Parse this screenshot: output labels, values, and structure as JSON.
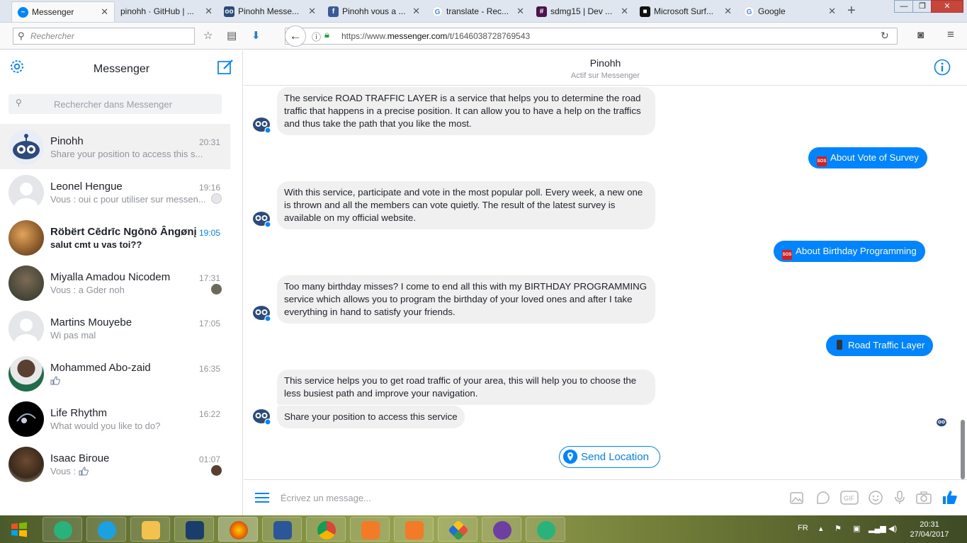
{
  "browser": {
    "tabs": [
      {
        "label": "Messenger",
        "favicon": "messenger-icon",
        "color": "#0084ff"
      },
      {
        "label": "pinohh · GitHub | ...",
        "favicon": "github-icon",
        "color": "#222222"
      },
      {
        "label": "Pinohh Messe...",
        "favicon": "pinohh-icon",
        "color": "#2c4a7a"
      },
      {
        "label": "Pinohh vous a ...",
        "favicon": "facebook-icon",
        "color": "#3b5998"
      },
      {
        "label": "translate - Rec...",
        "favicon": "google-icon",
        "color": "#4285f4"
      },
      {
        "label": "sdmg15 | Dev ...",
        "favicon": "slack-icon",
        "color": "#4a154b"
      },
      {
        "label": "Microsoft Surf...",
        "favicon": "ms-icon",
        "color": "#111111"
      },
      {
        "label": "Google",
        "favicon": "google-icon",
        "color": "#4285f4"
      }
    ],
    "search_placeholder": "Rechercher",
    "url_prefix": "https://www.",
    "url_domain": "messenger.com",
    "url_path": "/t/1646038728769543"
  },
  "sidebar": {
    "title": "Messenger",
    "search_placeholder": "Rechercher dans Messenger",
    "conversations": [
      {
        "name": "Pinohh",
        "snippet": "Share your position to access this s...",
        "time": "20:31",
        "selected": true,
        "unread": false
      },
      {
        "name": "Leonel Hengue",
        "snippet": "Vous : oui c pour utiliser sur messen...",
        "time": "19:16",
        "selected": false,
        "unread": false
      },
      {
        "name": "Röbërt Cēdrīc Ngōnō Ângønį",
        "snippet": "salut cmt u vas toi??",
        "time": "19:05",
        "selected": false,
        "unread": true
      },
      {
        "name": "Miyalla Amadou Nicodem",
        "snippet": "Vous : a Gder noh",
        "time": "17:31",
        "selected": false,
        "unread": false
      },
      {
        "name": "Martins Mouyebe",
        "snippet": "Wi pas mal",
        "time": "17:05",
        "selected": false,
        "unread": false
      },
      {
        "name": "Mohammed Abo-zaid",
        "snippet": "",
        "time": "16:35",
        "selected": false,
        "unread": false
      },
      {
        "name": "Life Rhythm",
        "snippet": "What would you like to do?",
        "time": "16:22",
        "selected": false,
        "unread": false
      },
      {
        "name": "Isaac Biroue",
        "snippet": "Vous :",
        "time": "01:07",
        "selected": false,
        "unread": false
      }
    ]
  },
  "chat": {
    "name": "Pinohh",
    "status": "Actif sur Messenger",
    "messages": [
      {
        "from": "bot",
        "text": "The service ROAD TRAFFIC LAYER is a service that helps you to determine the road traffic that happens in a precise position. It can allow you to have a help on the traffics and thus take the path that you like the most."
      },
      {
        "from": "me",
        "text": "About Vote of Survey"
      },
      {
        "from": "bot",
        "text": "With this service, participate and vote in the most popular poll. Every week, a new one is thrown and all the members can vote quietly. The result of the latest survey is available on my official website."
      },
      {
        "from": "me",
        "text": "About Birthday Programming"
      },
      {
        "from": "bot",
        "text": "Too many birthday misses? I come to end all this with my BIRTHDAY PROGRAMMING service which allows you to program the birthday of your loved ones and after I take everything in hand to satisfy your friends."
      },
      {
        "from": "me",
        "text": "Road Traffic Layer"
      },
      {
        "from": "bot",
        "text": "This service helps you to get road traffic of your area, this will help you to choose the less busiest path and improve your navigation."
      },
      {
        "from": "bot",
        "text": "Share your position to access this service"
      }
    ],
    "quick_reply": "Send Location",
    "composer_placeholder": "Écrivez un message..."
  },
  "taskbar": {
    "language": "FR",
    "time": "20:31",
    "date": "27/04/2017"
  },
  "colors": {
    "accent": "#0084ff",
    "bubble_in": "#f1f0f0"
  }
}
